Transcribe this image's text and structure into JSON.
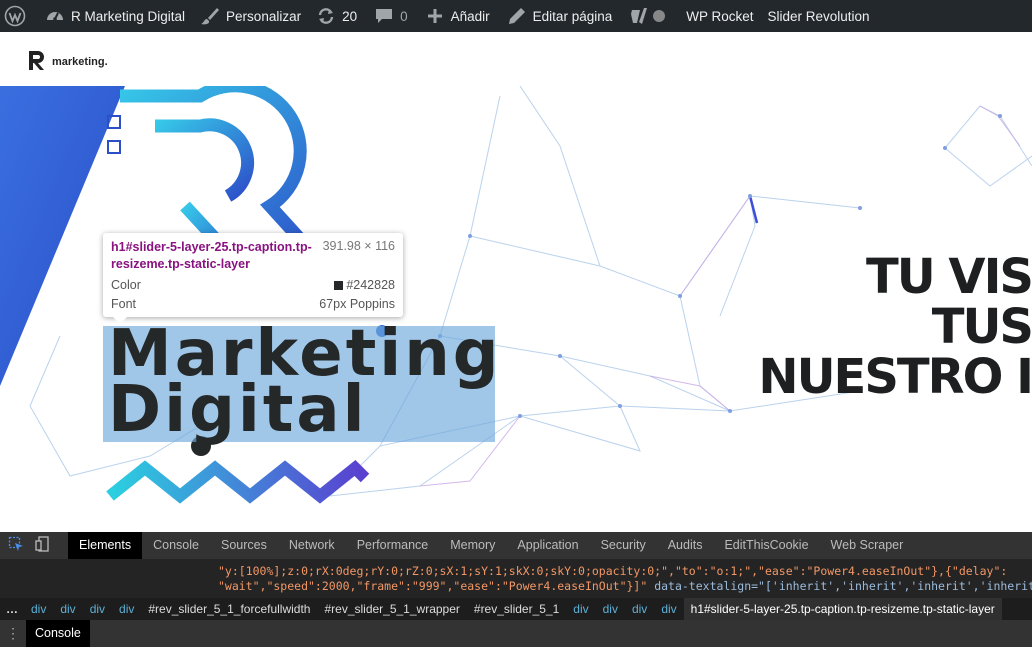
{
  "admin_bar": {
    "site_name": "R Marketing Digital",
    "customize": "Personalizar",
    "updates_count": "20",
    "comments_count": "0",
    "add_new": "Añadir",
    "edit_page": "Editar página",
    "wp_rocket": "WP Rocket",
    "slider_revolution": "Slider Revolution"
  },
  "header": {
    "logo_text": "marketing."
  },
  "hero": {
    "title_line1": "Marketing",
    "title_line2": "Digital",
    "tagline_line1": "TU VIS",
    "tagline_line2": "TUS",
    "tagline_line3": "NUESTRO I"
  },
  "inspect_tooltip": {
    "selector": "h1#slider-5-layer-25.tp-caption.tp-resizeme.tp-static-layer",
    "size": "391.98 × 116",
    "color_label": "Color",
    "color_value": "#242828",
    "font_label": "Font",
    "font_value": "67px Poppins"
  },
  "devtools": {
    "tabs": [
      "Elements",
      "Console",
      "Sources",
      "Network",
      "Performance",
      "Memory",
      "Application",
      "Security",
      "Audits",
      "EditThisCookie",
      "Web Scraper"
    ],
    "code_line1": "\"y:[100%];z:0;rX:0deg;rY:0;rZ:0;sX:1;sY:1;skX:0;skY:0;opacity:0;\",\"to\":\"o:1;\",\"ease\":\"Power4.easeInOut\"},{\"delay\":",
    "code_line2a": "\"wait\",\"speed\":2000,\"frame\":\"999\",\"ease\":\"Power4.easeInOut\"}]\"",
    "code_line2b": " data-textalign=\"['inherit','inherit','inherit','inherit']\"",
    "breadcrumbs": [
      "div",
      "div",
      "div",
      "div",
      "#rev_slider_5_1_forcefullwidth",
      "#rev_slider_5_1_wrapper",
      "#rev_slider_5_1",
      "div",
      "div",
      "div",
      "div",
      "h1#slider-5-layer-25.tp-caption.tp-resizeme.tp-static-layer"
    ],
    "drawer_tab": "Console"
  },
  "colors": {
    "admin_bar_bg": "#23282d",
    "title_text": "#242828",
    "highlight": "#6fa8dc",
    "devtools_bg": "#242424"
  }
}
